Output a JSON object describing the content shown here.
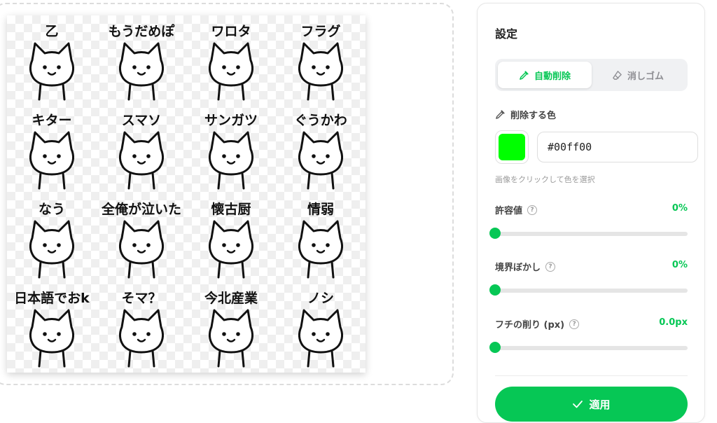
{
  "stickers": [
    {
      "label": "乙"
    },
    {
      "label": "もうだめぽ"
    },
    {
      "label": "ワロタ"
    },
    {
      "label": "フラグ"
    },
    {
      "label": "キター"
    },
    {
      "label": "スマソ"
    },
    {
      "label": "サンガツ"
    },
    {
      "label": "ぐうかわ"
    },
    {
      "label": "なう"
    },
    {
      "label": "全俺が泣いた"
    },
    {
      "label": "懐古厨"
    },
    {
      "label": "情弱"
    },
    {
      "label": "日本語でおk"
    },
    {
      "label": "そマ？"
    },
    {
      "label": "今北産業"
    },
    {
      "label": "ノシ"
    }
  ],
  "panel": {
    "title": "設定",
    "modes": [
      {
        "label": "自動削除",
        "icon": "eyedropper-icon",
        "active": true
      },
      {
        "label": "消しゴム",
        "icon": "eraser-icon",
        "active": false
      }
    ],
    "color_section": {
      "label": "削除する色",
      "swatch_color": "#00ff00",
      "hex_value": "#00ff00",
      "hint": "画像をクリックして色を選択"
    },
    "sliders": [
      {
        "label": "許容値",
        "value": "0%",
        "fraction": 0
      },
      {
        "label": "境界ぼかし",
        "value": "0%",
        "fraction": 0
      },
      {
        "label": "フチの削り (px)",
        "value": "0.0px",
        "fraction": 0
      }
    ],
    "apply_label": "適用"
  },
  "colors": {
    "accent": "#06c755",
    "track": "#e5e5e5"
  }
}
